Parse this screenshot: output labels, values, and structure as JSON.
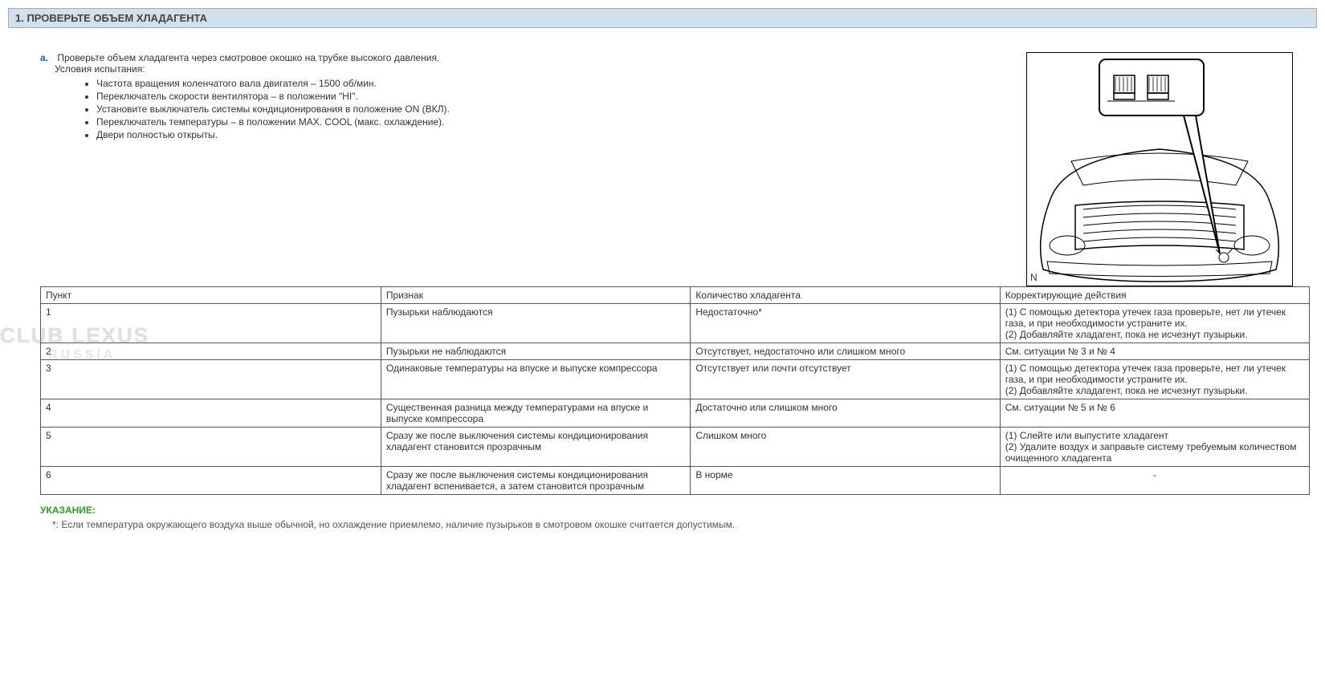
{
  "section": {
    "title": "1. ПРОВЕРЬТЕ ОБЪЕМ ХЛАДАГЕНТА"
  },
  "step": {
    "letter": "a.",
    "text": "Проверьте объем хладагента через смотровое окошко на трубке высокого давления.",
    "condition_label": "Условия испытания:",
    "conditions": [
      "Частота вращения коленчатого вала двигателя – 1500 об/мин.",
      "Переключатель скорости вентилятора – в положении \"HI\".",
      "Установите выключатель системы кондиционирования в положение ON (ВКЛ).",
      "Переключатель температуры – в положении MAX. COOL (макс. охлаждение).",
      "Двери полностью открыты."
    ]
  },
  "diagram": {
    "corner_label": "N"
  },
  "table": {
    "headers": {
      "item": "Пункт",
      "sign": "Признак",
      "qty": "Количество хладагента",
      "action": "Корректирующие действия"
    },
    "rows": [
      {
        "item": "1",
        "sign": "Пузырьки наблюдаются",
        "qty": "Недостаточно*",
        "action": "(1) С помощью детектора утечек газа проверьте, нет ли утечек газа, и при необходимости устраните их.\n(2) Добавляйте хладагент, пока не исчезнут пузырьки."
      },
      {
        "item": "2",
        "sign": "Пузырьки не наблюдаются",
        "qty": "Отсутствует, недостаточно или слишком много",
        "action": "См. ситуации № 3 и № 4"
      },
      {
        "item": "3",
        "sign": "Одинаковые температуры на впуске и выпуске компрессора",
        "qty": "Отсутствует или почти отсутствует",
        "action": "(1) С помощью детектора утечек газа проверьте, нет ли утечек газа, и при необходимости устраните их.\n(2) Добавляйте хладагент, пока не исчезнут пузырьки."
      },
      {
        "item": "4",
        "sign": "Существенная разница между температурами на впуске и выпуске компрессора",
        "qty": "Достаточно или слишком много",
        "action": "См. ситуации № 5 и № 6"
      },
      {
        "item": "5",
        "sign": "Сразу же после выключения системы кондиционирования хладагент становится прозрачным",
        "qty": "Слишком много",
        "action": "(1) Слейте или выпустите хладагент\n(2) Удалите воздух и заправьте систему требуемым количеством очищенного хладагента"
      },
      {
        "item": "6",
        "sign": "Сразу же после выключения системы кондиционирования хладагент вспенивается, а затем становится прозрачным",
        "qty": "В норме",
        "action": "-"
      }
    ]
  },
  "note": {
    "label": "УКАЗАНИЕ:",
    "text": "*: Если температура окружающего воздуха выше обычной, но охлаждение приемлемо, наличие пузырьков в смотровом окошке считается допустимым."
  },
  "watermark": {
    "main": "CLUB LEXUS",
    "sub": "RUSSIA"
  }
}
